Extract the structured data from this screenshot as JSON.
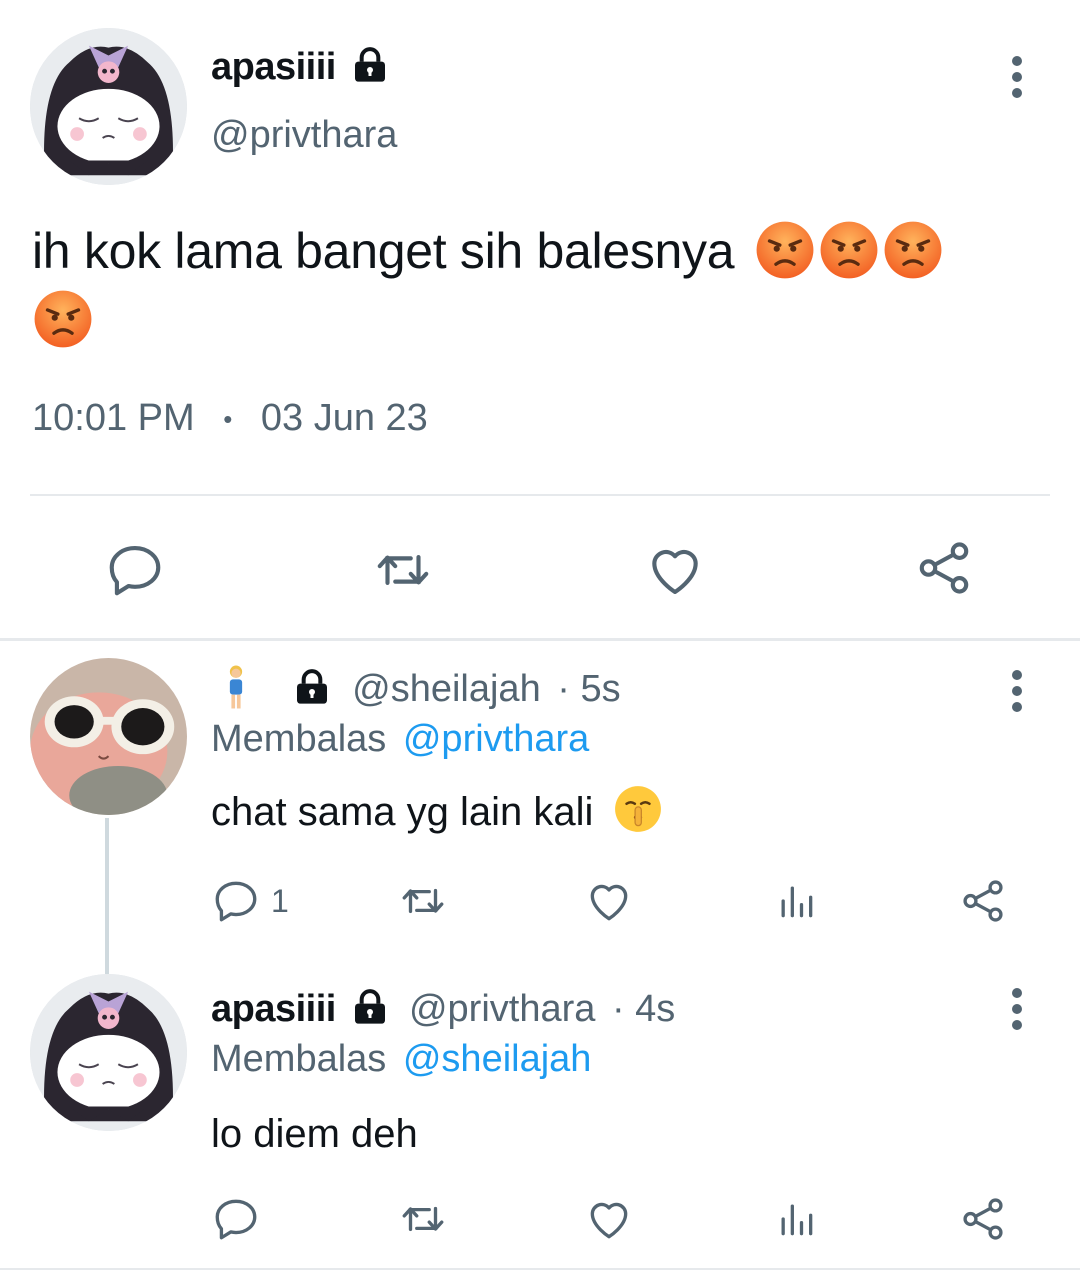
{
  "main_tweet": {
    "display_name": "apasiiii",
    "handle": "@privthara",
    "text": "ih kok lama banget sih balesnya",
    "emojis": [
      "angry-face",
      "angry-face",
      "angry-face",
      "angry-face"
    ],
    "time": "10:01 PM",
    "dot": "•",
    "date": "03 Jun 23",
    "actions": [
      "reply",
      "retweet",
      "like",
      "share"
    ]
  },
  "replies": [
    {
      "display_name_emoji": "woman-standing",
      "handle": "@sheilajah",
      "age": "· 5s",
      "replying_label": "Membalas",
      "replying_to": "@privthara",
      "text": "chat sama yg lain kali",
      "text_emoji": "shushing-face",
      "reply_count": "1"
    },
    {
      "display_name": "apasiiii",
      "handle": "@privthara",
      "age": "· 4s",
      "replying_label": "Membalas",
      "replying_to": "@sheilajah",
      "text": "lo diem deh",
      "reply_count": ""
    }
  ],
  "colors": {
    "text": "#0f1419",
    "muted": "#536471",
    "link": "#1d9bf0",
    "divider": "#e6e9ec"
  }
}
